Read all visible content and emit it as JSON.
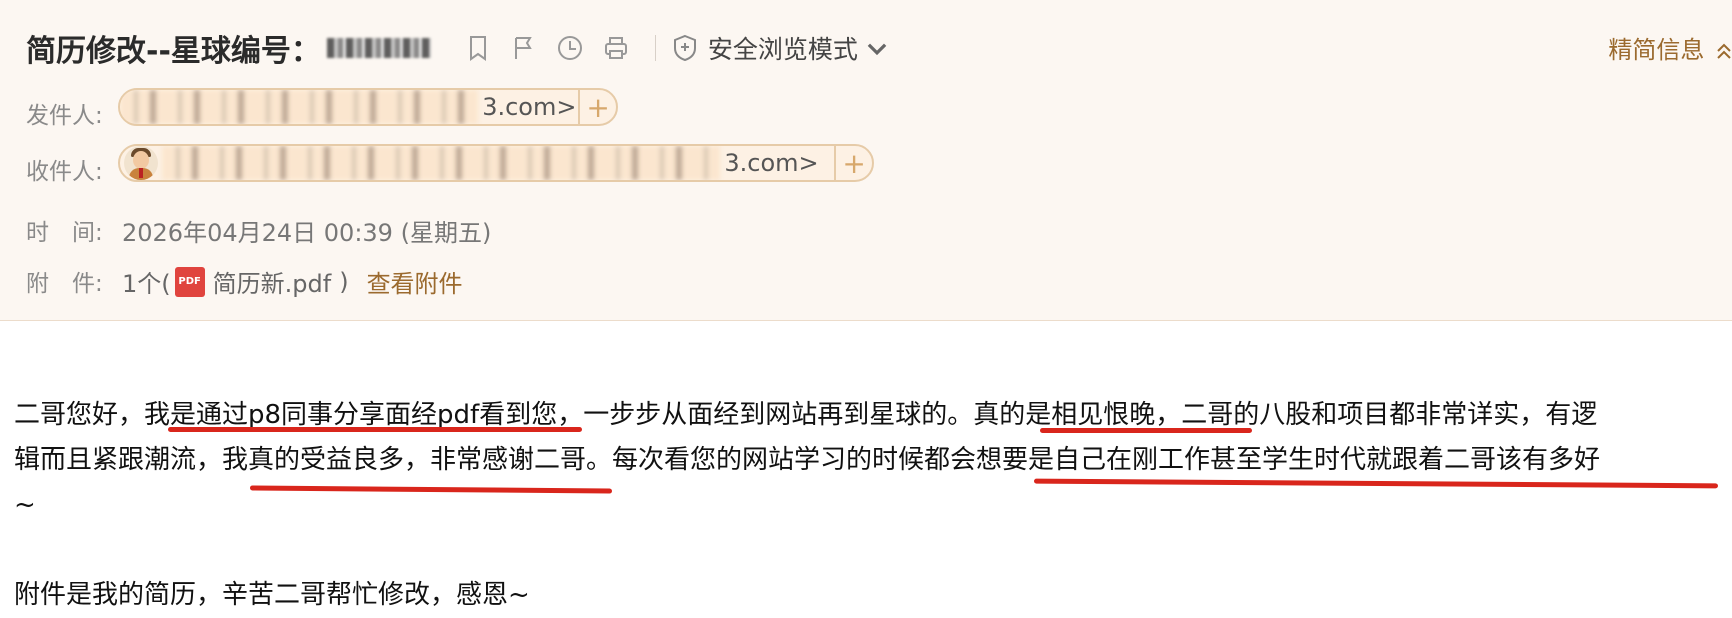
{
  "header": {
    "subject": "简历修改--星球编号：",
    "safe_mode": "安全浏览模式",
    "compact_link": "精简信息",
    "sender_label": "发件人:",
    "sender_addr_tail": "3.com>",
    "recipient_label": "收件人:",
    "recipient_addr_tail": "3.com>",
    "time_label": "时　间:",
    "time_value": "2026年04月24日 00:39 (星期五)",
    "attach_label": "附　件:",
    "attach_count": "1个(",
    "attach_name": "简历新.pdf",
    "attach_close": ")",
    "view_attach": "查看附件",
    "pdf_badge": "PDF",
    "plus": "+"
  },
  "icons": [
    "bookmark-icon",
    "flag-icon",
    "clock-icon",
    "printer-icon",
    "shield-icon",
    "chevron-down-icon",
    "double-chevron-up-icon"
  ],
  "body": {
    "line1": "二哥您好，我是通过p8同事分享面经pdf看到您，一步步从面经到网站再到星球的。真的是相见恨晚，二哥的八股和项目都非常详实，有逻",
    "line2": "辑而且紧跟潮流，我真的受益良多，非常感谢二哥。每次看您的网站学习的时候都会想要是自己在刚工作甚至学生时代就跟着二哥该有多好",
    "line3": "~",
    "line4": "附件是我的简历，辛苦二哥帮忙修改，感恩~"
  },
  "colors": {
    "accent": "#9b6a2e",
    "underline": "#d9261c",
    "header_bg": "#fcf7f2"
  }
}
